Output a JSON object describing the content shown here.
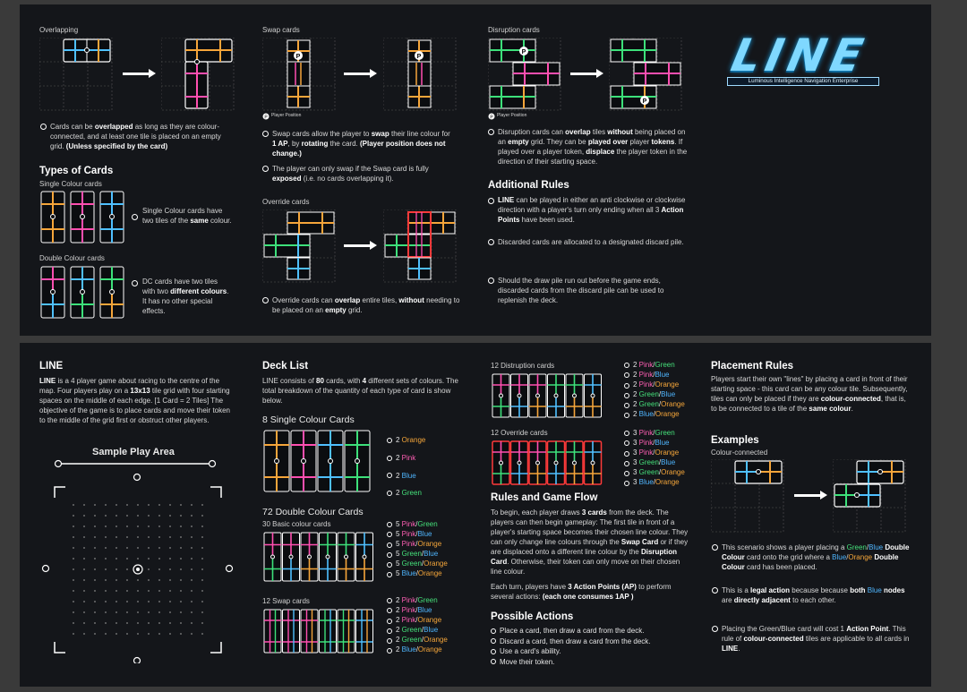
{
  "logo": {
    "title": "LINE",
    "subtitle": "Luminous Intelligence Navigation Enterprise"
  },
  "colors": {
    "pink": "#ff4fb0",
    "green": "#3de07a",
    "blue": "#4fc0ff",
    "orange": "#f5a53a",
    "red": "#ff3a3a",
    "panel": "#14161a"
  },
  "top": {
    "overlap": {
      "label": "Overlapping",
      "bullet_pre": "Cards can be ",
      "bullet_b1": "overlapped",
      "bullet_mid": " as long as they are colour-connected, and at least one tile is placed on an empty grid. ",
      "bullet_b2": "(Unless specified by the card)"
    },
    "types": {
      "heading": "Types of Cards",
      "single_label": "Single Colour cards",
      "single_pre": "Single Colour cards have two tiles of the ",
      "single_b": "same",
      "single_post": " colour.",
      "double_label": "Double Colour cards",
      "double_pre": "DC cards have two tiles with two ",
      "double_b": "different colours",
      "double_post": ". It has no other special effects."
    },
    "swap": {
      "label": "Swap cards",
      "legend": "Player Position",
      "p1_pre": "Swap cards allow the player to ",
      "p1_b1": "swap",
      "p1_mid": " their line colour for ",
      "p1_b2": "1 AP",
      "p1_mid2": ", by ",
      "p1_b3": "rotating",
      "p1_mid3": " the card. ",
      "p1_b4": "(Player position does not change.)",
      "p2_pre": "The player can only swap if the Swap card is fully ",
      "p2_b": "exposed",
      "p2_post": " (i.e. no cards overlapping it)."
    },
    "override": {
      "label": "Override cards",
      "p_pre": "Override cards can ",
      "p_b1": "overlap",
      "p_mid": " entire tiles, ",
      "p_b2": "without",
      "p_mid2": " needing to be placed on an ",
      "p_b3": "empty",
      "p_post": " grid."
    },
    "disruption": {
      "label": "Disruption cards",
      "legend": "Player Position",
      "p_pre": "Disruption cards can ",
      "p_b1": "overlap",
      "p_mid": " tiles ",
      "p_b2": "without",
      "p_mid2": " being placed on an ",
      "p_b3": "empty",
      "p_mid3": " grid. They can be ",
      "p_b4": "played over",
      "p_mid4": " player ",
      "p_b5": "tokens",
      "p_mid5": ". If played over a player token, ",
      "p_b6": "displace",
      "p_post": " the player token in the direction of their starting space."
    },
    "additional": {
      "heading": "Additional Rules",
      "r1_b": "LINE",
      "r1_mid": " can be played in either an anti clockwise or clockwise direction with a player's turn only ending when all 3 ",
      "r1_b2": "Action Points",
      "r1_post": " have been used.",
      "r2": "Discarded cards are allocated to a designated discard pile.",
      "r3": "Should the draw pile run out before the game ends, discarded cards from the discard pile can be used to replenish the deck."
    }
  },
  "bottom": {
    "line": {
      "heading": "LINE",
      "p_b1": "LINE",
      "p_mid": " is a 4 player game about racing to the centre of the map. Four players play on a ",
      "p_b2": "13x13",
      "p_post": " tile grid with four starting spaces on the middle of each edge. [1 Card = 2 Tiles] The objective of the game is to place cards and move their token to the middle of the grid first or obstruct other players.",
      "sample": "Sample Play Area"
    },
    "deck": {
      "heading": "Deck List",
      "p_pre": "LINE consists of ",
      "p_b1": "80",
      "p_mid": " cards, with ",
      "p_b2": "4",
      "p_post": " different sets of colours. The total breakdown of the quantity of each type of card is show below.",
      "single_title": "8 Single Colour Cards",
      "single_list": [
        {
          "n": "2",
          "c": "Orange",
          "cls": "or"
        },
        {
          "n": "2",
          "c": "Pink",
          "cls": "pk"
        },
        {
          "n": "2",
          "c": "Blue",
          "cls": "bl"
        },
        {
          "n": "2",
          "c": "Green",
          "cls": "gr"
        }
      ],
      "double_title": "72 Double Colour Cards",
      "basic_label": "30 Basic colour cards",
      "basic_list": [
        [
          "5",
          "Pink",
          "Green"
        ],
        [
          "5",
          "Pink",
          "Blue"
        ],
        [
          "5",
          "Pink",
          "Orange"
        ],
        [
          "5",
          "Green",
          "Blue"
        ],
        [
          "5",
          "Green",
          "Orange"
        ],
        [
          "5",
          "Blue",
          "Orange"
        ]
      ],
      "swap_label": "12 Swap cards",
      "swap_list": [
        [
          "2",
          "Pink",
          "Green"
        ],
        [
          "2",
          "Pink",
          "Blue"
        ],
        [
          "2",
          "Pink",
          "Orange"
        ],
        [
          "2",
          "Green",
          "Blue"
        ],
        [
          "2",
          "Green",
          "Orange"
        ],
        [
          "2",
          "Blue",
          "Orange"
        ]
      ]
    },
    "dist": {
      "label": "12 Distruption cards",
      "list": [
        [
          "2",
          "Pink",
          "Green"
        ],
        [
          "2",
          "Pink",
          "Blue"
        ],
        [
          "2",
          "Pink",
          "Orange"
        ],
        [
          "2",
          "Green",
          "Blue"
        ],
        [
          "2",
          "Green",
          "Orange"
        ],
        [
          "2",
          "Blue",
          "Orange"
        ]
      ]
    },
    "over": {
      "label": "12 Override cards",
      "list": [
        [
          "3",
          "Pink",
          "Green"
        ],
        [
          "3",
          "Pink",
          "Blue"
        ],
        [
          "3",
          "Pink",
          "Orange"
        ],
        [
          "3",
          "Green",
          "Blue"
        ],
        [
          "3",
          "Green",
          "Orange"
        ],
        [
          "3",
          "Blue",
          "Orange"
        ]
      ]
    },
    "rules": {
      "heading": "Rules and Game Flow",
      "p1_pre": "To begin, each player draws ",
      "p1_b1": "3 cards",
      "p1_mid": " from the deck. The players can then begin gameplay: The first tile in front of a player's starting space becomes their chosen line colour. They can only change line colours through the ",
      "p1_b2": "Swap Card",
      "p1_mid2": " or if they are displaced onto a different line colour by the ",
      "p1_b3": "Disruption Card",
      "p1_post": ". Otherwise, their token can only move on their chosen line colour.",
      "p2_pre": "Each turn, players have ",
      "p2_b1": "3 Action Points (AP)",
      "p2_mid": " to perform several actions: ",
      "p2_b2": "(each one consumes 1AP )"
    },
    "actions": {
      "heading": "Possible Actions",
      "items": [
        "Place a card, then draw a card from the deck.",
        "Discard a card, then draw a card from the deck.",
        "Use a card's ability.",
        "Move their token."
      ]
    },
    "placement": {
      "heading": "Placement Rules",
      "p_pre": "Players start their own \"lines\" by placing a card in front of their starting space - this card can be any colour tile. Subsequently, tiles can only be placed if they are ",
      "p_b1": "colour-connected",
      "p_mid": ", that is, to be connected to a tile of the ",
      "p_b2": "same colour",
      "p_post": ".",
      "ex_heading": "Examples",
      "ex_label": "Colour-connected",
      "e1_pre": "This scenario shows a player placing a ",
      "e1_g": "Green",
      "e1_s": "/",
      "e1_bl": "Blue",
      "e1_b1": "Double Colour",
      "e1_mid": " card onto the grid where a ",
      "e1_b": "Blue",
      "e1_s2": "/",
      "e1_o": "Orange",
      "e1_b2": "Double Colour",
      "e1_post": " card has been placed.",
      "e2_pre": "This is a ",
      "e2_b1": "legal action",
      "e2_mid": " because because ",
      "e2_b2": "both",
      "e2_blue": "Blue",
      "e2_b3": "nodes",
      "e2_mid2": " are ",
      "e2_b4": "directly adjacent",
      "e2_post": " to each other.",
      "e3_pre": "Placing the Green/Blue card will cost 1 ",
      "e3_b1": "Action Point",
      "e3_mid": ". This rule of ",
      "e3_b2": "colour-connected",
      "e3_mid2": " tiles are applicable to all cards in ",
      "e3_b3": "LINE",
      "e3_post": "."
    }
  }
}
